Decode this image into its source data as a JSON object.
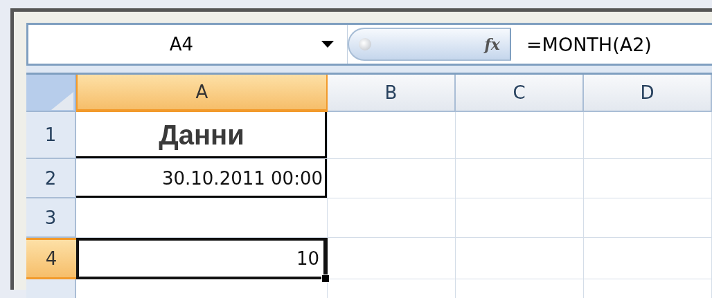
{
  "name_box": {
    "value": "A4"
  },
  "formula_bar": {
    "fx": "fx",
    "value": "=MONTH(A2)"
  },
  "columns": [
    {
      "label": "A",
      "selected": true
    },
    {
      "label": "B",
      "selected": false
    },
    {
      "label": "C",
      "selected": false
    },
    {
      "label": "D",
      "selected": false
    }
  ],
  "rows": [
    {
      "label": "1",
      "selected": false,
      "cells": [
        {
          "text": "Данни",
          "bold": true,
          "bordered": true,
          "active": false
        }
      ]
    },
    {
      "label": "2",
      "selected": false,
      "cells": [
        {
          "text": "30.10.2011 00:00",
          "bold": false,
          "bordered": true,
          "active": false
        }
      ]
    },
    {
      "label": "3",
      "selected": false,
      "cells": []
    },
    {
      "label": "4",
      "selected": true,
      "cells": [
        {
          "text": "10",
          "bold": false,
          "bordered": false,
          "active": true
        }
      ]
    }
  ]
}
